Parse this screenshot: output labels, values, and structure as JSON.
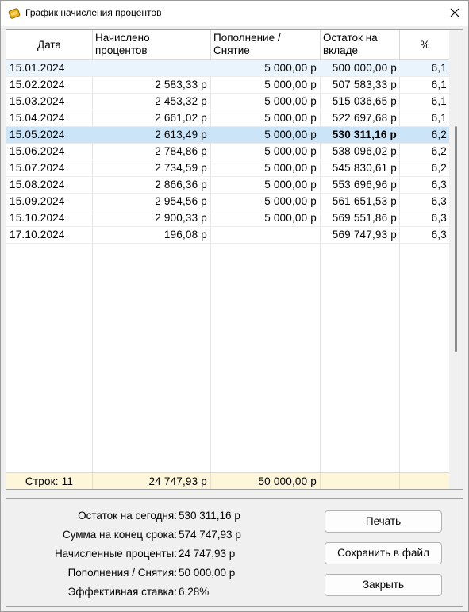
{
  "window": {
    "title": "График начисления процентов"
  },
  "table": {
    "headers": {
      "date": "Дата",
      "interest": [
        "Начислено",
        "процентов"
      ],
      "deposit": [
        "Пополнение /",
        "Снятие"
      ],
      "balance": [
        "Остаток на",
        "вкладе"
      ],
      "rate": "%"
    },
    "rows": [
      {
        "date": "15.01.2024",
        "interest": "",
        "deposit": "5 000,00 р",
        "balance": "500 000,00 р",
        "rate": "6,1"
      },
      {
        "date": "15.02.2024",
        "interest": "2 583,33 р",
        "deposit": "5 000,00 р",
        "balance": "507 583,33 р",
        "rate": "6,1"
      },
      {
        "date": "15.03.2024",
        "interest": "2 453,32 р",
        "deposit": "5 000,00 р",
        "balance": "515 036,65 р",
        "rate": "6,1"
      },
      {
        "date": "15.04.2024",
        "interest": "2 661,02 р",
        "deposit": "5 000,00 р",
        "balance": "522 697,68 р",
        "rate": "6,1"
      },
      {
        "date": "15.05.2024",
        "interest": "2 613,49 р",
        "deposit": "5 000,00 р",
        "balance": "530 311,16 р",
        "rate": "6,2",
        "selected": true
      },
      {
        "date": "15.06.2024",
        "interest": "2 784,86 р",
        "deposit": "5 000,00 р",
        "balance": "538 096,02 р",
        "rate": "6,2"
      },
      {
        "date": "15.07.2024",
        "interest": "2 734,59 р",
        "deposit": "5 000,00 р",
        "balance": "545 830,61 р",
        "rate": "6,2"
      },
      {
        "date": "15.08.2024",
        "interest": "2 866,36 р",
        "deposit": "5 000,00 р",
        "balance": "553 696,96 р",
        "rate": "6,3"
      },
      {
        "date": "15.09.2024",
        "interest": "2 954,56 р",
        "deposit": "5 000,00 р",
        "balance": "561 651,53 р",
        "rate": "6,3"
      },
      {
        "date": "15.10.2024",
        "interest": "2 900,33 р",
        "deposit": "5 000,00 р",
        "balance": "569 551,86 р",
        "rate": "6,3"
      },
      {
        "date": "17.10.2024",
        "interest": "196,08 р",
        "deposit": "",
        "balance": "569 747,93 р",
        "rate": "6,3"
      }
    ],
    "footer": {
      "rows_label": "Строк: 11",
      "interest_total": "24 747,93 р",
      "deposit_total": "50 000,00 р"
    }
  },
  "summary": {
    "items": [
      {
        "label": "Остаток на сегодня:",
        "value": "530 311,16 р"
      },
      {
        "label": "Сумма на конец срока:",
        "value": "574 747,93 р"
      },
      {
        "label": "Начисленные проценты:",
        "value": "24 747,93 р"
      },
      {
        "label": "Пополнения / Снятия:",
        "value": "50 000,00 р"
      },
      {
        "label": "Эффективная ставка:",
        "value": "6,28%"
      }
    ]
  },
  "buttons": {
    "print": "Печать",
    "save": "Сохранить в файл",
    "close": "Закрыть"
  },
  "icons": {
    "app": "coin-stack-icon",
    "close": "close-icon"
  },
  "colors": {
    "selected_row": "#cce4f7",
    "first_row": "#eaf4fc",
    "footer_row": "#fdf6da"
  }
}
